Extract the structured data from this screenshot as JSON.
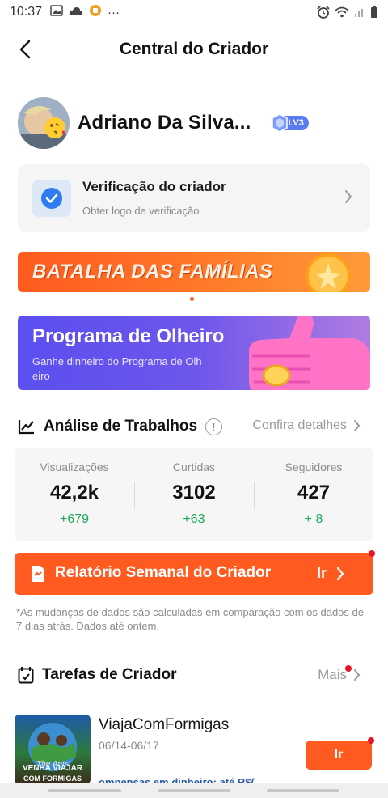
{
  "status_bar": {
    "time": "10:37",
    "more": "···"
  },
  "header": {
    "title": "Central do Criador"
  },
  "profile": {
    "name": "Adriano Da Silva...",
    "level": "LV3"
  },
  "verification": {
    "title": "Verificação do criador",
    "subtitle": "Obter logo de verificação"
  },
  "banners": {
    "batalha": {
      "text": "BATALHA DAS FAMÍLIAS"
    },
    "olheiro": {
      "title": "Programa de Olheiro",
      "subtitle_line1": "Ganhe dinheiro do Programa de Olh",
      "subtitle_line2": "eiro"
    }
  },
  "analysis": {
    "title": "Análise de Trabalhos",
    "info": "!",
    "details_link": "Confira detalhes",
    "stats": [
      {
        "label": "Visualizações",
        "value": "42,2k",
        "delta": "+679"
      },
      {
        "label": "Curtidas",
        "value": "3102",
        "delta": "+63"
      },
      {
        "label": "Seguidores",
        "value": "427",
        "delta": "+ 8"
      }
    ]
  },
  "weekly_report": {
    "label": "Relatório Semanal do Criador",
    "go": "Ir"
  },
  "note": "*As mudanças de dados são calculadas em comparação com os dados de 7 dias atrás. Dados até ontem.",
  "tasks": {
    "title": "Tarefas de Criador",
    "more": "Mais",
    "items": [
      {
        "name": "ViajaComFormigas",
        "dates": "06/14-06/17",
        "reward": "ompensas em dinheiro: até R$(",
        "go": "Ir",
        "thumb_text1": "VENHA VIAJAR",
        "thumb_text2": "COM FORMIGAS",
        "thumb_ants": "The Ants"
      }
    ]
  },
  "colors": {
    "accent": "#ff5a1f",
    "positive": "#1fa85a",
    "badge": "#5b7cf0"
  }
}
